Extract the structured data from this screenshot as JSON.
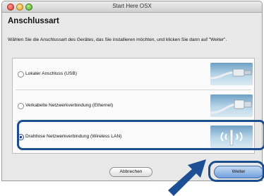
{
  "window": {
    "title": "Start Here OSX"
  },
  "header": {
    "heading": "Anschlussart"
  },
  "description": "Wählen Sie die Anschlussart des Gerätes, das Sie installieren möchten, und klicken Sie dann auf \"Weiter\".",
  "options": [
    {
      "label": "Lokaler Anschluss (USB)",
      "selected": false,
      "icon": "usb-cable-icon"
    },
    {
      "label": "Verkabelte Netzwerkverbindung (Ethernet)",
      "selected": false,
      "icon": "ethernet-cable-icon"
    },
    {
      "label": "Drahtlose Netzwerkverbindung (Wireless LAN)",
      "selected": true,
      "icon": "wireless-antenna-icon"
    }
  ],
  "buttons": {
    "cancel": "Abbrechen",
    "next": "Weiter"
  },
  "colors": {
    "highlight": "#1a4c8f",
    "accent_button": "#6f9fdc"
  }
}
